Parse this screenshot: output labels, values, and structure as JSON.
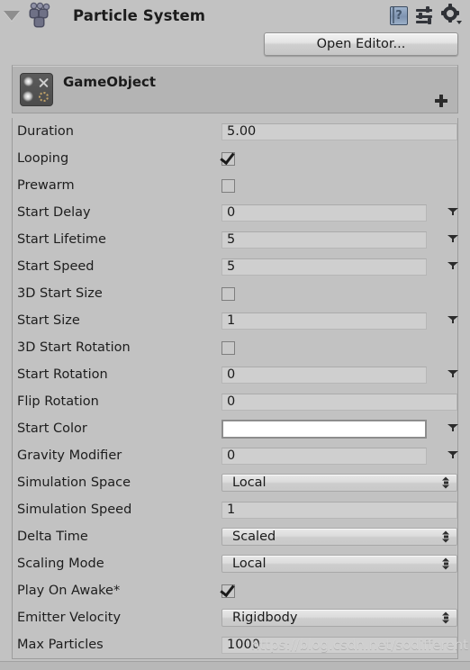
{
  "component": {
    "title": "Particle System",
    "foldout_expanded": true,
    "icon": "particle-system-icon",
    "header_icons": [
      {
        "name": "help-icon",
        "glyph": "?"
      },
      {
        "name": "preset-icon",
        "glyph": "sliders"
      },
      {
        "name": "settings-gear-icon",
        "glyph": "gear"
      }
    ]
  },
  "toolbar": {
    "open_editor_label": "Open Editor..."
  },
  "gameobject": {
    "name": "GameObject",
    "icon": "particle-effect-icon",
    "add_label": "+"
  },
  "properties": [
    {
      "label": "Duration",
      "type": "number",
      "value": "5.00",
      "width": "wide"
    },
    {
      "label": "Looping",
      "type": "checkbox",
      "value": true
    },
    {
      "label": "Prewarm",
      "type": "checkbox",
      "value": false
    },
    {
      "label": "Start Delay",
      "type": "curve",
      "value": "0"
    },
    {
      "label": "Start Lifetime",
      "type": "curve",
      "value": "5"
    },
    {
      "label": "Start Speed",
      "type": "curve",
      "value": "5"
    },
    {
      "label": "3D Start Size",
      "type": "checkbox",
      "value": false
    },
    {
      "label": "Start Size",
      "type": "curve",
      "value": "1"
    },
    {
      "label": "3D Start Rotation",
      "type": "checkbox",
      "value": false
    },
    {
      "label": "Start Rotation",
      "type": "curve",
      "value": "0"
    },
    {
      "label": "Flip Rotation",
      "type": "number",
      "value": "0",
      "width": "wide"
    },
    {
      "label": "Start Color",
      "type": "color",
      "value": "#ffffff"
    },
    {
      "label": "Gravity Modifier",
      "type": "curve",
      "value": "0"
    },
    {
      "label": "Simulation Space",
      "type": "popup",
      "value": "Local"
    },
    {
      "label": "Simulation Speed",
      "type": "number",
      "value": "1",
      "width": "wide"
    },
    {
      "label": "Delta Time",
      "type": "popup",
      "value": "Scaled"
    },
    {
      "label": "Scaling Mode",
      "type": "popup",
      "value": "Local"
    },
    {
      "label": "Play On Awake*",
      "type": "checkbox",
      "value": true
    },
    {
      "label": "Emitter Velocity",
      "type": "popup",
      "value": "Rigidbody"
    },
    {
      "label": "Max Particles",
      "type": "number",
      "value": "1000",
      "width": "wide"
    }
  ],
  "watermark": {
    "text": "https://blog.csdn.net/sodifferent"
  },
  "colors": {
    "panel_background": "#c2c2c2",
    "subheader_background": "#b4b4b4",
    "field_background": "#cfcfcf",
    "text": "#1d1d1d",
    "start_color_swatch": "#ffffff"
  }
}
